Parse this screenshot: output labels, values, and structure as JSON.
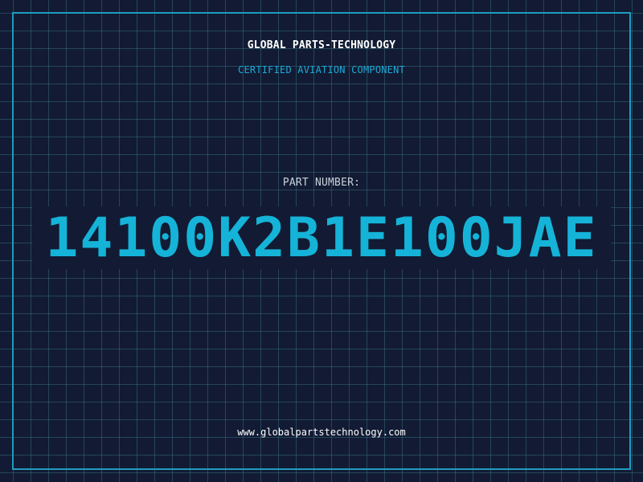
{
  "header": {
    "company": "GLOBAL PARTS-TECHNOLOGY",
    "tagline": "CERTIFIED AVIATION COMPONENT"
  },
  "part": {
    "label": "PART NUMBER:",
    "number": "14100K2B1E100JAE"
  },
  "footer": {
    "website": "www.globalpartstechnology.com"
  },
  "colors": {
    "background": "#121b33",
    "grid": "#3c788c",
    "frame": "#1e9cc0",
    "accent": "#15b3d8",
    "title": "#ffffff",
    "label": "#c8d2dc"
  }
}
